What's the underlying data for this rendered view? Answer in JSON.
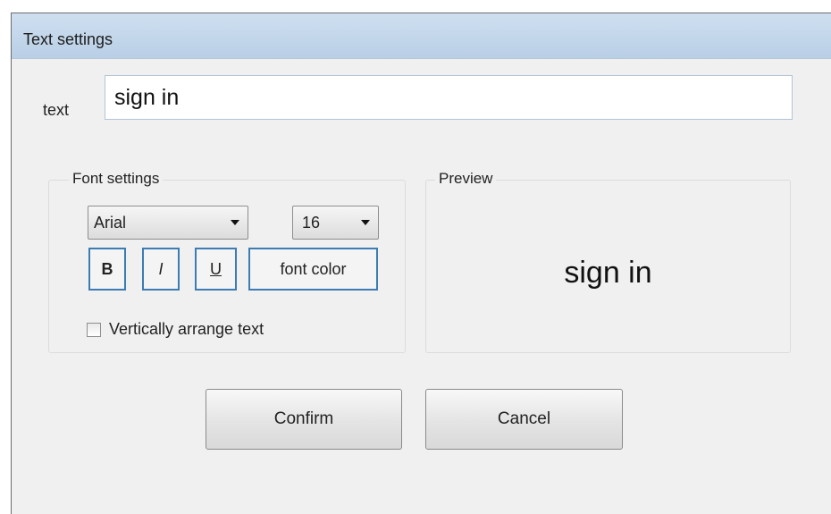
{
  "dialog": {
    "title": "Text settings"
  },
  "text_field": {
    "label": "text",
    "value": "sign in"
  },
  "font_settings": {
    "legend": "Font settings",
    "font_family": "Arial",
    "font_size": "16",
    "bold_label": "B",
    "italic_label": "I",
    "underline_label": "U",
    "font_color_label": "font color",
    "vertical_label": "Vertically arrange text",
    "vertical_checked": false
  },
  "preview": {
    "legend": "Preview",
    "text": "sign in"
  },
  "buttons": {
    "confirm": "Confirm",
    "cancel": "Cancel"
  },
  "colors": {
    "titlebar": "#c4d8ee",
    "accent_border": "#3d7bb3"
  }
}
